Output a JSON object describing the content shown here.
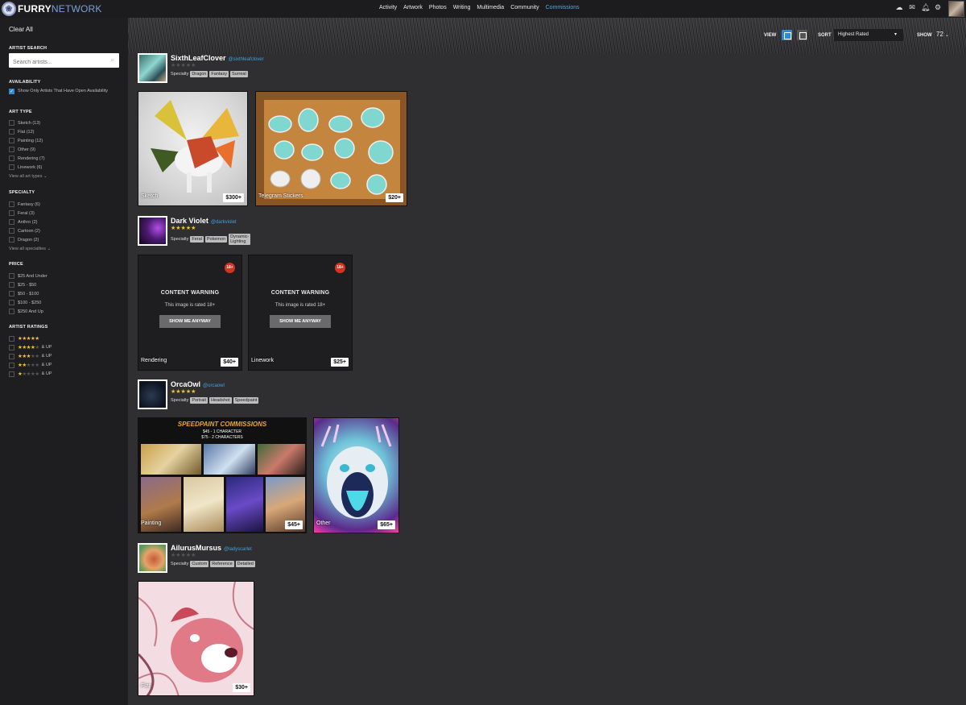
{
  "brand": {
    "furry": "FURRY",
    "network": "NETWORK"
  },
  "nav": [
    "Activity",
    "Artwork",
    "Photos",
    "Writing",
    "Multimedia",
    "Community",
    "Commissions"
  ],
  "nav_active": "Commissions",
  "sidebar": {
    "clear_all": "Clear All",
    "artist_search": {
      "title": "ARTIST SEARCH",
      "placeholder": "Search artists..."
    },
    "availability": {
      "title": "AVAILABILITY",
      "option": "Show Only Artists That Have Open Availability"
    },
    "art_type": {
      "title": "ART TYPE",
      "items": [
        "Sketch (13)",
        "Flat (12)",
        "Painting (12)",
        "Other (9)",
        "Rendering (7)",
        "Linework (6)"
      ],
      "view_all": "View all art types"
    },
    "specialty": {
      "title": "SPECIALTY",
      "items": [
        "Fantasy (6)",
        "Feral (3)",
        "Anthro (2)",
        "Cartoon (2)",
        "Dragon (2)"
      ],
      "view_all": "View all specialties"
    },
    "price": {
      "title": "PRICE",
      "items": [
        "$25 And Under",
        "$25 - $50",
        "$50 - $100",
        "$100 - $250",
        "$250 And Up"
      ]
    },
    "ratings": {
      "title": "ARTIST RATINGS",
      "items": [
        {
          "stars": 5,
          "suffix": ""
        },
        {
          "stars": 4,
          "suffix": "& UP"
        },
        {
          "stars": 3,
          "suffix": "& UP"
        },
        {
          "stars": 2,
          "suffix": "& UP"
        },
        {
          "stars": 1,
          "suffix": "& UP"
        }
      ]
    }
  },
  "toolbar": {
    "view_label": "VIEW",
    "sort_label": "SORT",
    "sort_value": "Highest Rated",
    "show_label": "SHOW",
    "show_value": "72"
  },
  "specialty_label": "Specialty",
  "artists": [
    {
      "name": "SixthLeafClover",
      "handle": "@sixthleafclover",
      "rating": 0,
      "tags": [
        "Dragon",
        "Fantasy",
        "Surreal"
      ],
      "cards": [
        {
          "label": "Sketch",
          "price": "$300+"
        },
        {
          "label": "Telegram Stickers",
          "price": "$20+"
        }
      ]
    },
    {
      "name": "Dark Violet",
      "handle": "@darkviolet",
      "rating": 5,
      "tags": [
        "Feral",
        "Pokemon",
        "Dynamic-Lighting"
      ],
      "cards": [
        {
          "label": "Rendering",
          "price": "$40+"
        },
        {
          "label": "Linework",
          "price": "$25+"
        }
      ]
    },
    {
      "name": "OrcaOwl",
      "handle": "@orcaowl",
      "rating": 5,
      "tags": [
        "Portrait",
        "Headshot",
        "Speedpaint"
      ],
      "cards": [
        {
          "label": "Painting",
          "price": "$45+"
        },
        {
          "label": "Other",
          "price": "$65+"
        }
      ]
    },
    {
      "name": "AilurusMursus",
      "handle": "@ladyscarlet",
      "rating": 0,
      "tags": [
        "Custom",
        "Reference",
        "Detailed"
      ],
      "cards": [
        {
          "label": "Flat",
          "price": "$30+"
        }
      ]
    }
  ],
  "content_warning": {
    "badge": "18+",
    "title": "CONTENT WARNING",
    "subtitle": "This image is rated 18+",
    "button": "SHOW ME ANYWAY"
  },
  "speedpaint_banner": {
    "title": "SPEEDPAINT COMMISSIONS",
    "line1": "$45 - 1 CHARACTER",
    "line2": "$75 - 2 CHARACTERS"
  },
  "colors": {
    "accent": "#2e8bd3",
    "link": "#3fa1e0",
    "star": "#f2c230",
    "warning": "#d6321f"
  },
  "icons": [
    "cloud-upload-icon",
    "mail-icon",
    "bell-icon",
    "gear-icon"
  ]
}
